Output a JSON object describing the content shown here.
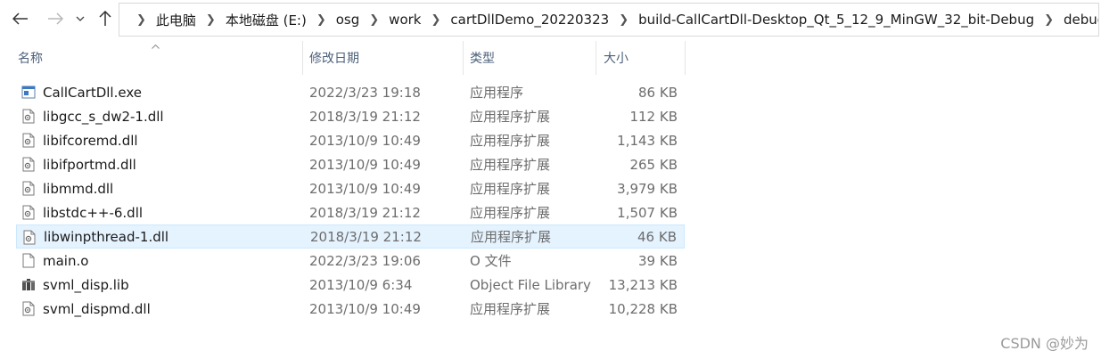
{
  "nav": {
    "back_icon": "arrow-left-icon",
    "forward_icon": "arrow-right-icon",
    "recent_icon": "chevron-down-icon",
    "up_icon": "arrow-up-icon"
  },
  "breadcrumb": [
    "此电脑",
    "本地磁盘 (E:)",
    "osg",
    "work",
    "cartDllDemo_20220323",
    "build-CallCartDll-Desktop_Qt_5_12_9_MinGW_32_bit-Debug",
    "debug"
  ],
  "columns": {
    "name": "名称",
    "date": "修改日期",
    "type": "类型",
    "size": "大小"
  },
  "files": [
    {
      "name": "CallCartDll.exe",
      "date": "2022/3/23 19:18",
      "type": "应用程序",
      "size": "86 KB",
      "icon": "exe-icon"
    },
    {
      "name": "libgcc_s_dw2-1.dll",
      "date": "2018/3/19 21:12",
      "type": "应用程序扩展",
      "size": "112 KB",
      "icon": "dll-icon"
    },
    {
      "name": "libifcoremd.dll",
      "date": "2013/10/9 10:49",
      "type": "应用程序扩展",
      "size": "1,143 KB",
      "icon": "dll-icon"
    },
    {
      "name": "libifportmd.dll",
      "date": "2013/10/9 10:49",
      "type": "应用程序扩展",
      "size": "265 KB",
      "icon": "dll-icon"
    },
    {
      "name": "libmmd.dll",
      "date": "2013/10/9 10:49",
      "type": "应用程序扩展",
      "size": "3,979 KB",
      "icon": "dll-icon"
    },
    {
      "name": "libstdc++-6.dll",
      "date": "2018/3/19 21:12",
      "type": "应用程序扩展",
      "size": "1,507 KB",
      "icon": "dll-icon"
    },
    {
      "name": "libwinpthread-1.dll",
      "date": "2018/3/19 21:12",
      "type": "应用程序扩展",
      "size": "46 KB",
      "icon": "dll-icon"
    },
    {
      "name": "main.o",
      "date": "2022/3/23 19:06",
      "type": "O 文件",
      "size": "39 KB",
      "icon": "file-icon"
    },
    {
      "name": "svml_disp.lib",
      "date": "2013/10/9 6:34",
      "type": "Object File Library",
      "size": "13,213 KB",
      "icon": "lib-icon"
    },
    {
      "name": "svml_dispmd.dll",
      "date": "2013/10/9 10:49",
      "type": "应用程序扩展",
      "size": "10,228 KB",
      "icon": "dll-icon"
    }
  ],
  "selected_index": 6,
  "watermark": "CSDN @妙为"
}
